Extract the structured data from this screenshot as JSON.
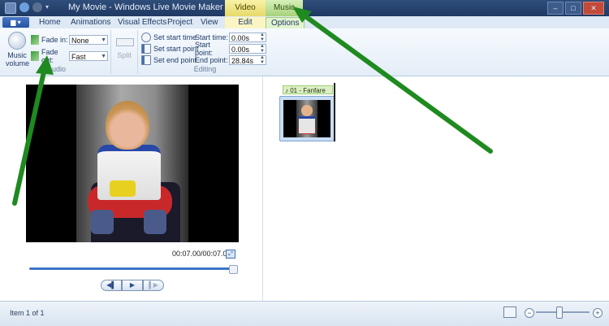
{
  "titlebar": {
    "app_title": "My Movie - Windows Live Movie Maker",
    "context_tabs": {
      "video_tools": "Video Tools",
      "music_tools": "Music Tools"
    },
    "window_controls": {
      "minimize": "–",
      "maximize": "□",
      "close": "✕"
    },
    "app_menu": "▆ ▾",
    "qat_dropdown": "▾"
  },
  "tabs": [
    {
      "label": "Home"
    },
    {
      "label": "Animations"
    },
    {
      "label": "Visual Effects"
    },
    {
      "label": "Project"
    },
    {
      "label": "View"
    },
    {
      "label": "Edit"
    },
    {
      "label": "Options"
    }
  ],
  "ribbon": {
    "audio": {
      "music_volume_label": "Music volume",
      "fade_in_label": "Fade in:",
      "fade_in_value": "None",
      "fade_out_label": "Fade out:",
      "fade_out_value": "Fast",
      "group_label": "Audio"
    },
    "split": {
      "label": "Split"
    },
    "editing": {
      "set_start_time": "Set start time",
      "set_start_point": "Set start point",
      "set_end_point": "Set end point",
      "start_time_label": "Start time:",
      "start_time_value": "0.00s",
      "start_point_label": "Start point:",
      "start_point_value": "0.00s",
      "end_point_label": "End point:",
      "end_point_value": "28.84s",
      "group_label": "Editing"
    }
  },
  "preview": {
    "timecode": "00:07.00/00:07.00",
    "playback_progress": 1.0,
    "fullscreen_glyph": "⤢",
    "transport": {
      "prev": "◀▌",
      "play": "▶",
      "next": "▌▶"
    }
  },
  "storyboard": {
    "music_label": "♪ 01 - Fanfare"
  },
  "statusbar": {
    "status_text": "Item 1 of 1",
    "zoom_out": "−",
    "zoom_in": "+",
    "zoom_level": 0.42
  },
  "colors": {
    "titlebar": "#1f3a63",
    "video_tools_tab": "#e6d96a",
    "music_tools_tab": "#a8d27c",
    "annotation_arrow": "#1f8a1f",
    "seekbar": "#3c74c6"
  },
  "icons": [
    "music-volume-icon",
    "fade-in-icon",
    "fade-out-icon",
    "split-icon",
    "set-start-time-icon",
    "set-start-point-icon",
    "set-end-point-icon",
    "fullscreen-icon",
    "storyboard-icon"
  ]
}
